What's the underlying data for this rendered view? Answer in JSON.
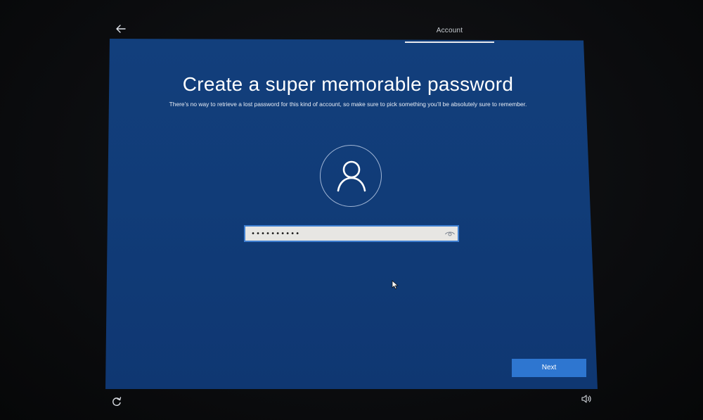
{
  "header": {
    "back_icon": "back-arrow-icon",
    "active_tab": "Account"
  },
  "main": {
    "title": "Create a super memorable password",
    "subtitle": "There’s no way to retrieve a lost password for this kind of account, so make sure to pick something you’ll be absolutely sure to remember.",
    "avatar_icon": "user-avatar-icon",
    "password": {
      "value": "••••••••••",
      "reveal_icon": "eye-icon"
    }
  },
  "footer": {
    "next_label": "Next",
    "ease_of_access_icon": "ease-of-access-icon",
    "volume_icon": "volume-icon"
  },
  "colors": {
    "screen_blue": "#123f7c",
    "accent_button": "#2e76d0",
    "field_border": "#3f7fd0"
  }
}
